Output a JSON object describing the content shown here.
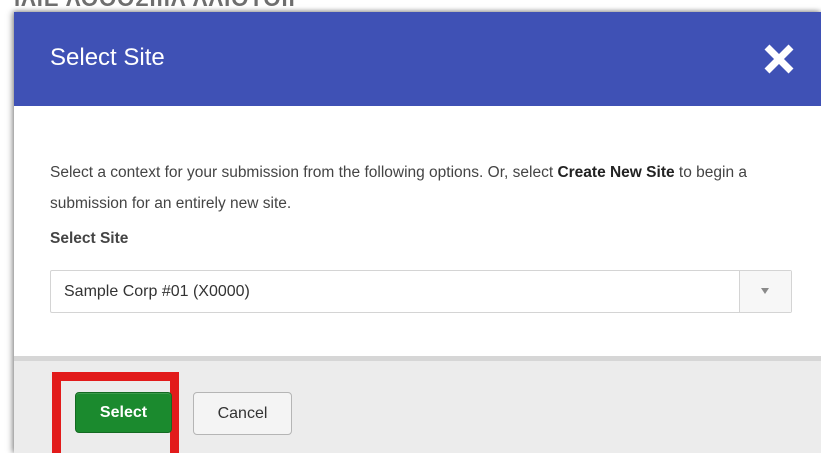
{
  "background": {
    "partial_heading": "ΙΛΙΕ ΛΟΟΟΣΙΙΙΛ ΛΛΙΟΤΟΙΙ"
  },
  "modal": {
    "title": "Select Site",
    "close_icon": "close-icon",
    "description_part1": "Select a context for your submission from the following options. Or, select ",
    "description_bold": "Create New Site",
    "description_part2": " to begin a submission for an entirely new site.",
    "field_label": "Select Site",
    "select_value": "Sample Corp #01 (X0000)",
    "select_label": "Select",
    "cancel_label": "Cancel"
  },
  "colors": {
    "header": "#3f51b5",
    "primary_button": "#1b8a2e",
    "highlight": "#e21b1b",
    "footer": "#ececec"
  }
}
